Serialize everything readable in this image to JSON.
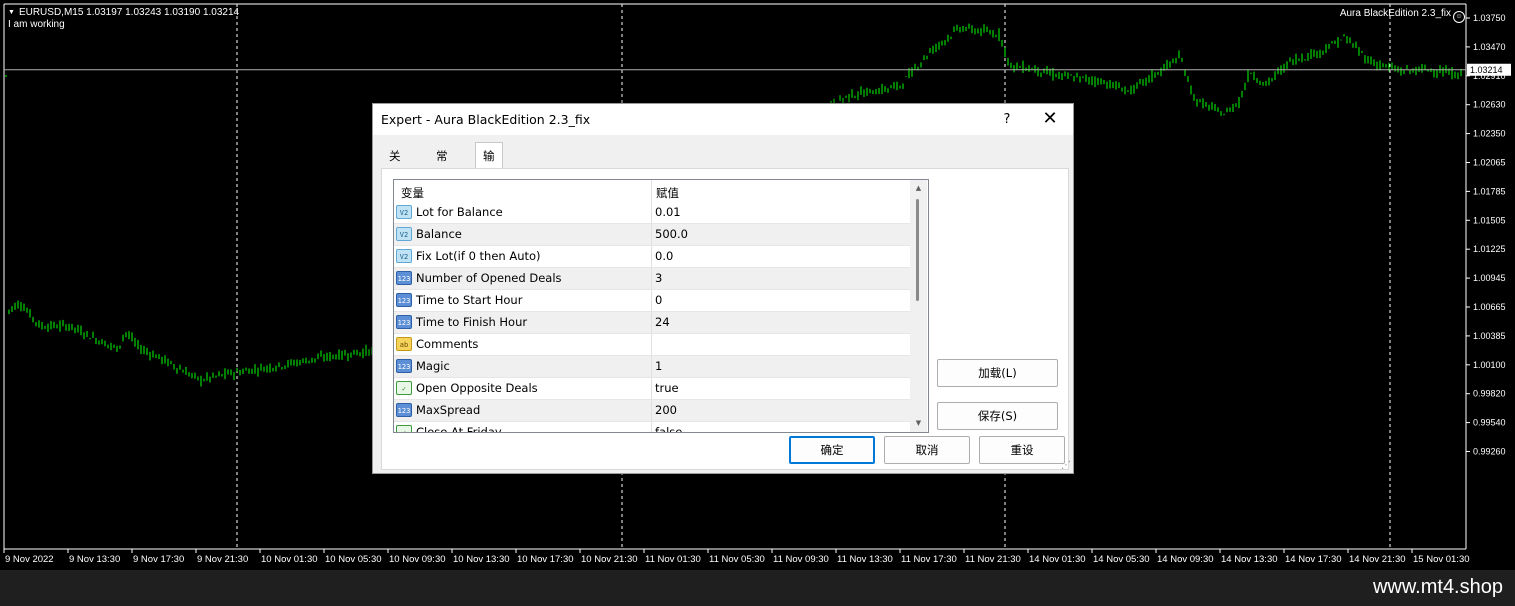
{
  "chart": {
    "symbol_info": "EURUSD,M15  1.03197 1.03243 1.03190 1.03214",
    "status_text": "I am working",
    "ea_label": "Aura BlackEdition 2.3_fix",
    "current_price": "1.03214",
    "price_labels": [
      "1.03750",
      "1.03470",
      "1.02910",
      "1.02630",
      "1.02350",
      "1.02065",
      "1.01785",
      "1.01505",
      "1.01225",
      "1.00945",
      "1.00665",
      "1.00385",
      "1.00100",
      "0.99820",
      "0.99540",
      "0.99260"
    ],
    "time_labels": [
      "9 Nov 2022",
      "9 Nov 13:30",
      "9 Nov 17:30",
      "9 Nov 21:30",
      "10 Nov 01:30",
      "10 Nov 05:30",
      "10 Nov 09:30",
      "10 Nov 13:30",
      "10 Nov 17:30",
      "10 Nov 21:30",
      "11 Nov 01:30",
      "11 Nov 05:30",
      "11 Nov 09:30",
      "11 Nov 13:30",
      "11 Nov 17:30",
      "11 Nov 21:30",
      "14 Nov 01:30",
      "14 Nov 05:30",
      "14 Nov 09:30",
      "14 Nov 13:30",
      "14 Nov 17:30",
      "14 Nov 21:30",
      "15 Nov 01:30"
    ],
    "colors": {
      "background": "#000000",
      "candles": "#00ff00",
      "grid": "#ffffff",
      "axis_text": "#ffffff"
    }
  },
  "watermark": "www.mt4.shop",
  "dialog": {
    "title": "Expert - Aura BlackEdition 2.3_fix",
    "help_label": "?",
    "close_label": "✕",
    "tabs": [
      {
        "label": "关于",
        "active": false
      },
      {
        "label": "常用",
        "active": false
      },
      {
        "label": "输入参数",
        "active": true
      }
    ],
    "grid": {
      "col_variable": "变量",
      "col_value": "赋值",
      "rows": [
        {
          "icon": "double-icon",
          "type": "dbl",
          "icon_text": "V2",
          "name": "Lot for Balance",
          "value": "0.01"
        },
        {
          "icon": "double-icon",
          "type": "dbl",
          "icon_text": "V2",
          "name": "Balance",
          "value": "500.0"
        },
        {
          "icon": "double-icon",
          "type": "dbl",
          "icon_text": "V2",
          "name": "Fix Lot(if 0 then Auto)",
          "value": "0.0"
        },
        {
          "icon": "integer-icon",
          "type": "int",
          "icon_text": "123",
          "name": "Number of Opened Deals",
          "value": "3"
        },
        {
          "icon": "integer-icon",
          "type": "int",
          "icon_text": "123",
          "name": "Time to Start Hour",
          "value": "0"
        },
        {
          "icon": "integer-icon",
          "type": "int",
          "icon_text": "123",
          "name": "Time to Finish Hour",
          "value": "24"
        },
        {
          "icon": "string-icon",
          "type": "str",
          "icon_text": "ab",
          "name": "Comments",
          "value": ""
        },
        {
          "icon": "integer-icon",
          "type": "int",
          "icon_text": "123",
          "name": "Magic",
          "value": "1"
        },
        {
          "icon": "bool-icon",
          "type": "bool",
          "icon_text": "✓",
          "name": "Open Opposite Deals",
          "value": "true"
        },
        {
          "icon": "integer-icon",
          "type": "int",
          "icon_text": "123",
          "name": "MaxSpread",
          "value": "200"
        },
        {
          "icon": "bool-icon",
          "type": "bool",
          "icon_text": "✓",
          "name": "Close At Friday",
          "value": "false"
        }
      ]
    },
    "buttons": {
      "load": "加载(L)",
      "save": "保存(S)",
      "ok": "确定",
      "cancel": "取消",
      "reset": "重设"
    }
  }
}
